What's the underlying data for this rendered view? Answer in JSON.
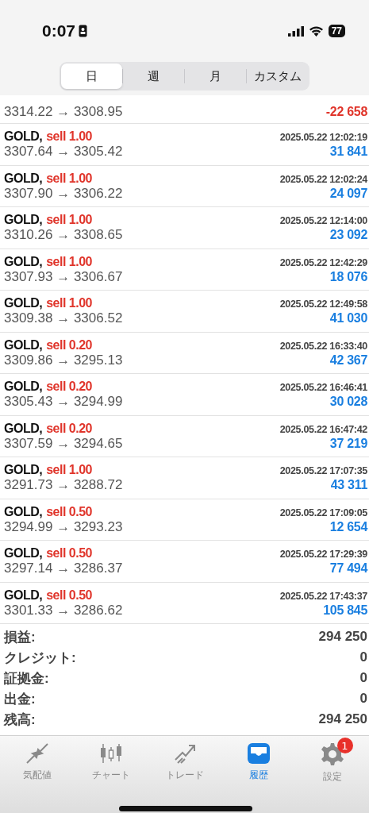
{
  "status_bar": {
    "time": "0:07",
    "battery": "77"
  },
  "period_tabs": [
    {
      "label": "日",
      "selected": true
    },
    {
      "label": "週",
      "selected": false
    },
    {
      "label": "月",
      "selected": false
    },
    {
      "label": "カスタム",
      "selected": false
    }
  ],
  "partial_row": {
    "prices": "3314.22 → 3308.95",
    "profit": "-22 658",
    "negative": true
  },
  "deals": [
    {
      "symbol": "GOLD,",
      "kind": "sell",
      "side": "sell",
      "volume": "1.00",
      "time": "2025.05.22 12:02:19",
      "prices": "3307.64 → 3305.42",
      "profit": "31 841",
      "negative": false
    },
    {
      "symbol": "GOLD,",
      "kind": "sell",
      "side": "sell",
      "volume": "1.00",
      "time": "2025.05.22 12:02:24",
      "prices": "3307.90 → 3306.22",
      "profit": "24 097",
      "negative": false
    },
    {
      "symbol": "GOLD,",
      "kind": "sell",
      "side": "sell",
      "volume": "1.00",
      "time": "2025.05.22 12:14:00",
      "prices": "3310.26 → 3308.65",
      "profit": "23 092",
      "negative": false
    },
    {
      "symbol": "GOLD,",
      "kind": "sell",
      "side": "sell",
      "volume": "1.00",
      "time": "2025.05.22 12:42:29",
      "prices": "3307.93 → 3306.67",
      "profit": "18 076",
      "negative": false
    },
    {
      "symbol": "GOLD,",
      "kind": "sell",
      "side": "sell",
      "volume": "1.00",
      "time": "2025.05.22 12:49:58",
      "prices": "3309.38 → 3306.52",
      "profit": "41 030",
      "negative": false
    },
    {
      "symbol": "GOLD,",
      "kind": "sell",
      "side": "sell",
      "volume": "0.20",
      "time": "2025.05.22 16:33:40",
      "prices": "3309.86 → 3295.13",
      "profit": "42 367",
      "negative": false
    },
    {
      "symbol": "GOLD,",
      "kind": "sell",
      "side": "sell",
      "volume": "0.20",
      "time": "2025.05.22 16:46:41",
      "prices": "3305.43 → 3294.99",
      "profit": "30 028",
      "negative": false
    },
    {
      "symbol": "GOLD,",
      "kind": "sell",
      "side": "sell",
      "volume": "0.20",
      "time": "2025.05.22 16:47:42",
      "prices": "3307.59 → 3294.65",
      "profit": "37 219",
      "negative": false
    },
    {
      "symbol": "GOLD,",
      "kind": "sell",
      "side": "sell",
      "volume": "1.00",
      "time": "2025.05.22 17:07:35",
      "prices": "3291.73 → 3288.72",
      "profit": "43 311",
      "negative": false
    },
    {
      "symbol": "GOLD,",
      "kind": "sell",
      "side": "sell",
      "volume": "0.50",
      "time": "2025.05.22 17:09:05",
      "prices": "3294.99 → 3293.23",
      "profit": "12 654",
      "negative": false
    },
    {
      "symbol": "GOLD,",
      "kind": "sell",
      "side": "sell",
      "volume": "0.50",
      "time": "2025.05.22 17:29:39",
      "prices": "3297.14 → 3286.37",
      "profit": "77 494",
      "negative": false
    },
    {
      "symbol": "GOLD,",
      "kind": "sell",
      "side": "sell",
      "volume": "0.50",
      "time": "2025.05.22 17:43:37",
      "prices": "3301.33 → 3286.62",
      "profit": "105 845",
      "negative": false
    }
  ],
  "summary": [
    {
      "label": "損益:",
      "value": "294 250"
    },
    {
      "label": "クレジット:",
      "value": "0"
    },
    {
      "label": "証拠金:",
      "value": "0"
    },
    {
      "label": "出金:",
      "value": "0"
    },
    {
      "label": "残高:",
      "value": "294 250"
    }
  ],
  "tab_bar": [
    {
      "kind": "quotes",
      "label": "気配値",
      "selected": false
    },
    {
      "kind": "chart",
      "label": "チャート",
      "selected": false
    },
    {
      "kind": "trade",
      "label": "トレード",
      "selected": false
    },
    {
      "kind": "history",
      "label": "履歴",
      "selected": true
    },
    {
      "kind": "settings",
      "label": "設定",
      "selected": false,
      "badge": "1"
    }
  ]
}
